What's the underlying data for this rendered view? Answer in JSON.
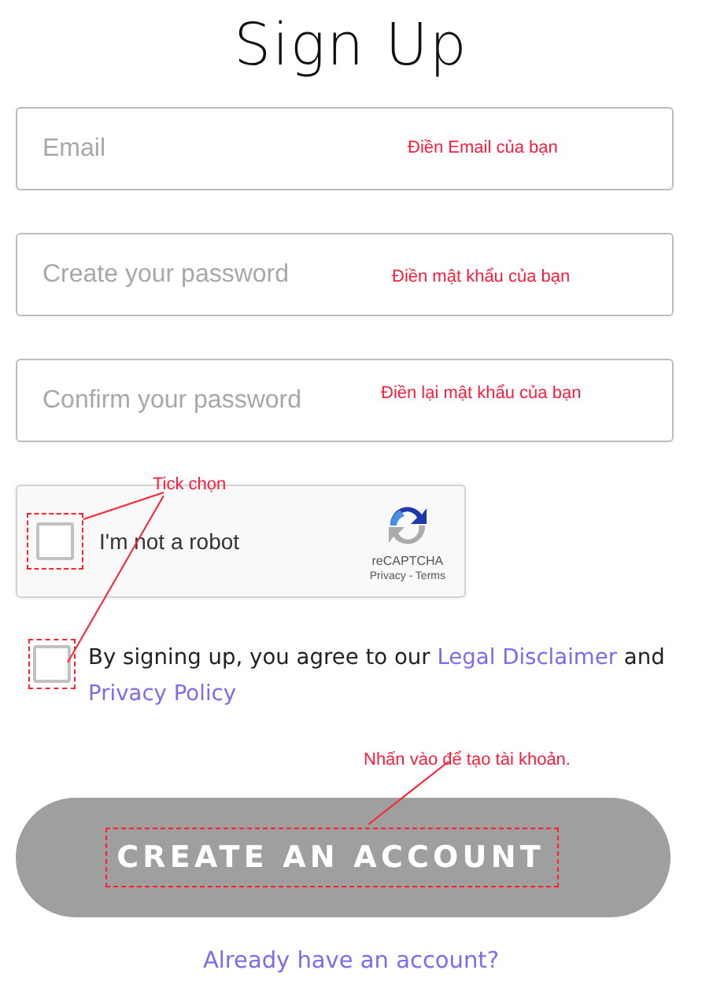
{
  "title": "Sign Up",
  "fields": [
    {
      "placeholder": "Email",
      "note": "Điền Email của bạn"
    },
    {
      "placeholder": "Create your password",
      "note": "Điền mật khẩu của bạn"
    },
    {
      "placeholder": "Confirm your password",
      "note": "Điền lại mật khẩu của bạn"
    }
  ],
  "captcha": {
    "label": "I'm not a robot",
    "checked": false,
    "brand": "reCAPTCHA",
    "footer": "Privacy - Terms"
  },
  "checkbox_note": "Tick chọn",
  "terms": {
    "checked": false,
    "text_before": "By signing up, you agree to our ",
    "link_1": "Legal Disclaimer",
    "text_middle": " and ",
    "link_2": "Privacy Policy"
  },
  "button": {
    "label": "CREATE AN ACCOUNT",
    "note": "Nhấn vào để tạo tài khoản."
  },
  "login_link": "Already have an account?"
}
